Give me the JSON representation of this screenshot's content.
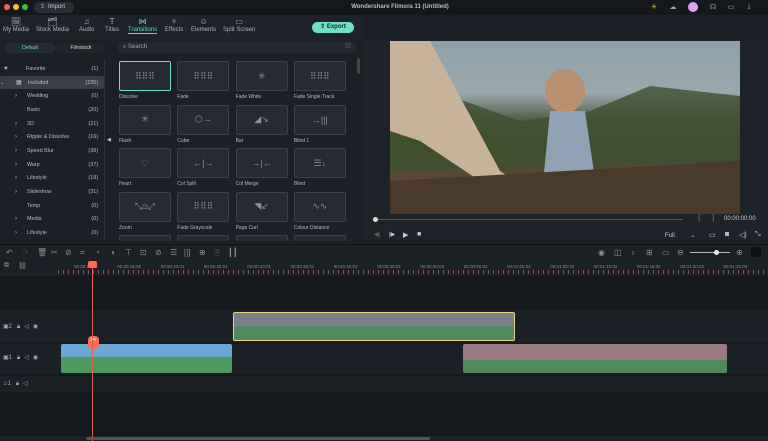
{
  "app": {
    "title": "Wondershare Filmora 11 (Untitled)",
    "import_label": "Import",
    "export_label": "Export"
  },
  "window_controls": {
    "colors": [
      "#ff5f57",
      "#febc2e",
      "#28c840"
    ]
  },
  "top_icons": [
    "bulb-icon",
    "cloud-icon",
    "avatar",
    "headset-icon",
    "inbox-icon",
    "download-icon"
  ],
  "tabs": [
    {
      "label": "My Media",
      "icon": "🖼"
    },
    {
      "label": "Stock Media",
      "icon": "🗂"
    },
    {
      "label": "Audio",
      "icon": "♫"
    },
    {
      "label": "Titles",
      "icon": "T"
    },
    {
      "label": "Transitions",
      "icon": "⋈",
      "active": true
    },
    {
      "label": "Effects",
      "icon": "✧"
    },
    {
      "label": "Elements",
      "icon": "☺"
    },
    {
      "label": "Split Screen",
      "icon": "▭"
    }
  ],
  "subtabs": [
    "Default",
    "Filmstock"
  ],
  "search": {
    "placeholder": "Search"
  },
  "categories": [
    {
      "label": "Favorite",
      "count": "(1)",
      "icon": "♥"
    },
    {
      "label": "Included",
      "count": "(235)",
      "icon": "▦",
      "selected": true,
      "expanded": true
    },
    {
      "label": "Wedding",
      "count": "(0)",
      "chev": true
    },
    {
      "label": "Basic",
      "count": "(20)"
    },
    {
      "label": "3D",
      "count": "(21)",
      "chev": true
    },
    {
      "label": "Ripple & Dissolve",
      "count": "(16)",
      "chev": true
    },
    {
      "label": "Speed Blur",
      "count": "(38)",
      "chev": true
    },
    {
      "label": "Warp",
      "count": "(37)",
      "chev": true
    },
    {
      "label": "Lifestyle",
      "count": "(19)",
      "chev": true
    },
    {
      "label": "Slideshow",
      "count": "(31)",
      "chev": true
    },
    {
      "label": "Temp",
      "count": "(0)"
    },
    {
      "label": "Media",
      "count": "(0)",
      "chev": true
    },
    {
      "label": "Lifestyle",
      "count": "(0)",
      "chev": true
    }
  ],
  "transitions": [
    {
      "label": "Dissolve",
      "glyph": "⠿⠿⠿",
      "selected": true
    },
    {
      "label": "Fade",
      "glyph": "⠿⠿⠿"
    },
    {
      "label": "Fade White",
      "glyph": "✳"
    },
    {
      "label": "Fade Single Track",
      "glyph": "⠿⠿⠿"
    },
    {
      "label": "Flash",
      "glyph": "✳"
    },
    {
      "label": "Cube",
      "glyph": "⬡→"
    },
    {
      "label": "Bar",
      "glyph": "◢↘"
    },
    {
      "label": "Blind 1",
      "glyph": "→|||"
    },
    {
      "label": "Heart",
      "glyph": "♡"
    },
    {
      "label": "Col Split",
      "glyph": "←|→"
    },
    {
      "label": "Col Merge",
      "glyph": "→|←"
    },
    {
      "label": "Blind",
      "glyph": "☰↓"
    },
    {
      "label": "Zoom",
      "glyph": "⤡⊡⤢"
    },
    {
      "label": "Fade Grayscale",
      "glyph": "⠿⠿⠿"
    },
    {
      "label": "Page Curl",
      "glyph": "◥↙"
    },
    {
      "label": "Colour Distance",
      "glyph": "∿∿"
    }
  ],
  "player": {
    "timecode": "00:00:00:00",
    "quality": "Full",
    "progress": 0
  },
  "ruler": [
    "00:00:10:00",
    "00:00:15:00",
    "00:00:20:01",
    "00:00:25:01",
    "00:00:30:01",
    "00:00:35:01",
    "00:00:40:01",
    "00:00:45:01",
    "00:00:50:02",
    "00:00:55:02",
    "00:01:00:02",
    "00:01:05:02",
    "00:01:10:02",
    "00:01:15:02",
    "00:01:20:02",
    "00:01:25:03"
  ],
  "tracks": [
    {
      "label": "2"
    },
    {
      "label": "1"
    },
    {
      "label": "1",
      "type": "audio"
    }
  ],
  "zoom_level": 0.7,
  "colors": {
    "accent": "#6de0c6",
    "playhead": "#ff6a50",
    "clip_selected": "#e8d58a"
  }
}
